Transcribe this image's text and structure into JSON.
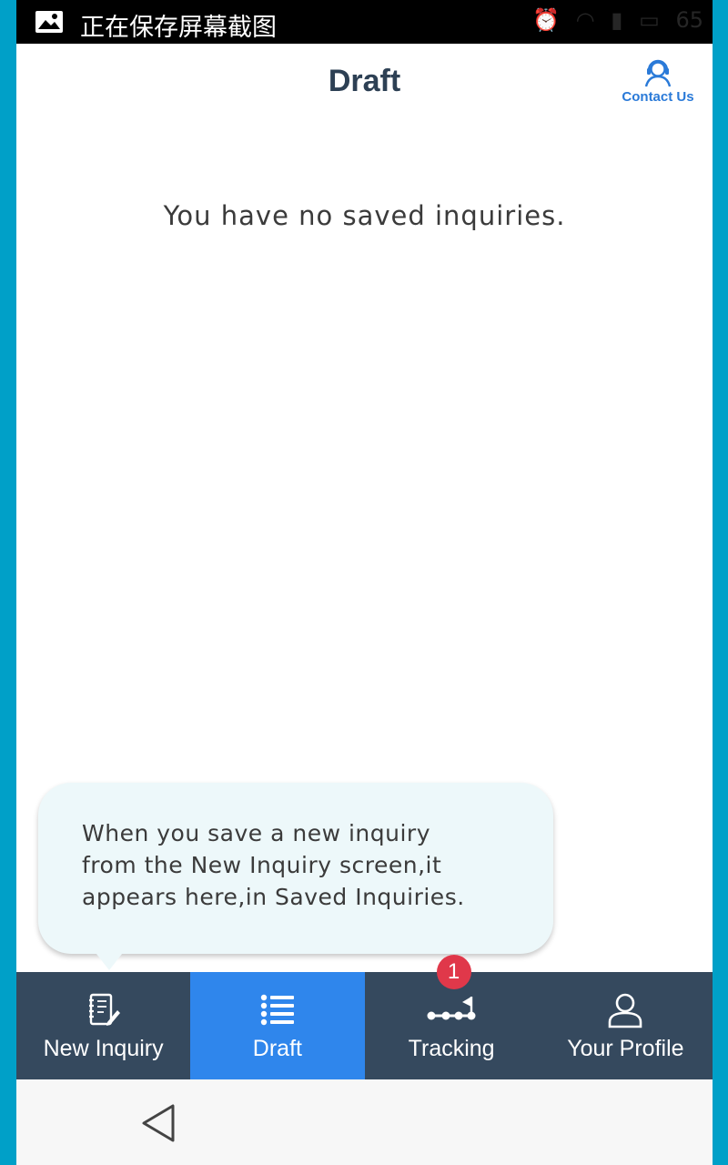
{
  "status_bar": {
    "text": "正在保存屏幕截图",
    "battery": "65",
    "icons": [
      "image-icon",
      "alarm-icon",
      "wifi-icon",
      "signal-icon",
      "battery-icon"
    ]
  },
  "header": {
    "title": "Draft",
    "contact_label": "Contact Us"
  },
  "main": {
    "empty_message": "You have no saved inquiries.",
    "tip": {
      "line1": "When you save a new inquiry",
      "line2": "from the New Inquiry screen,it",
      "line3": "appears here,in Saved Inquiries."
    }
  },
  "tabs": [
    {
      "label": "New Inquiry",
      "icon": "notebook-icon",
      "active": false
    },
    {
      "label": "Draft",
      "icon": "list-icon",
      "active": true
    },
    {
      "label": "Tracking",
      "icon": "tracking-icon",
      "active": false,
      "badge": "1"
    },
    {
      "label": "Your Profile",
      "icon": "profile-icon",
      "active": false
    }
  ],
  "colors": {
    "accent": "#2f86ec",
    "nav_bg": "#35495e",
    "badge": "#e0384a",
    "title": "#2d4054",
    "link": "#2a7ad8"
  }
}
